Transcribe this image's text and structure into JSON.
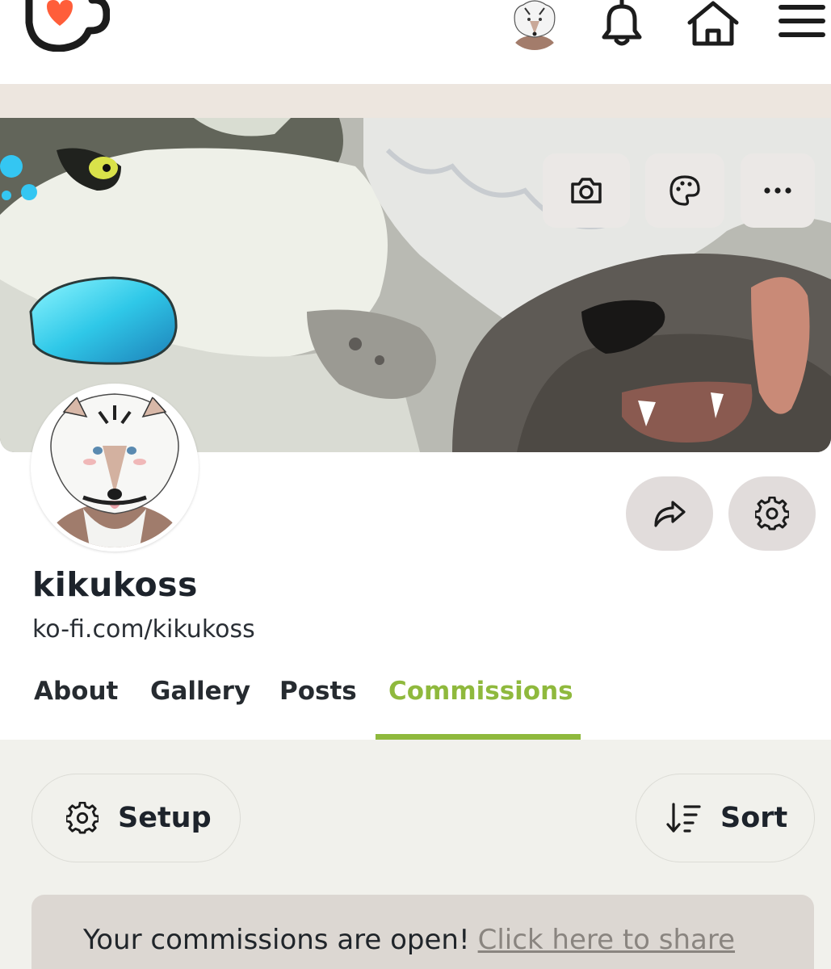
{
  "header": {
    "logo_icon": "kofi-cup-heart-icon",
    "avatar_icon": "user-avatar",
    "bell_icon": "bell-icon",
    "home_icon": "home-icon",
    "menu_icon": "hamburger-menu-icon"
  },
  "cover": {
    "buttons": [
      "camera-icon",
      "palette-icon",
      "more-dots-icon"
    ]
  },
  "profile": {
    "username": "kikukoss",
    "url": "ko-fi.com/kikukoss",
    "share_icon": "share-arrow-icon",
    "settings_icon": "gear-icon"
  },
  "tabs": [
    {
      "label": "About",
      "active": false
    },
    {
      "label": "Gallery",
      "active": false
    },
    {
      "label": "Posts",
      "active": false
    },
    {
      "label": "Commissions",
      "active": true
    }
  ],
  "commissions": {
    "setup_label": "Setup",
    "sort_label": "Sort",
    "notice_text": "Your commissions are open!",
    "notice_link": "Click here to share"
  },
  "colors": {
    "accent_green": "#8fb93d",
    "brand_orange": "#ff5e3a",
    "band_beige": "#ede6df",
    "lower_bg": "#f1f1ec",
    "notice_bg": "#dcd7d2"
  }
}
